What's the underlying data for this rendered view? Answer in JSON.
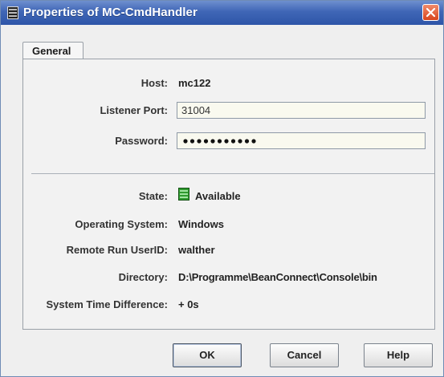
{
  "window": {
    "title": "Properties of MC-CmdHandler"
  },
  "tabs": [
    {
      "label": "General"
    }
  ],
  "form": {
    "host": {
      "label": "Host:",
      "value": "mc122"
    },
    "listener_port": {
      "label": "Listener Port:",
      "value": "31004"
    },
    "password": {
      "label": "Password:",
      "value": "•••••••••••"
    }
  },
  "info": {
    "state": {
      "label": "State:",
      "value": "Available",
      "icon": "server-available-icon"
    },
    "os": {
      "label": "Operating System:",
      "value": "Windows"
    },
    "userid": {
      "label": "Remote Run UserID:",
      "value": "walther"
    },
    "directory": {
      "label": "Directory:",
      "value": "D:\\Programme\\BeanConnect\\Console\\bin"
    },
    "time_diff": {
      "label": "System Time Difference:",
      "value": "+ 0s"
    }
  },
  "buttons": {
    "ok": "OK",
    "cancel": "Cancel",
    "help": "Help"
  },
  "colors": {
    "titlebar": "#3f66b6",
    "close": "#d8451d",
    "status_green": "#2f9a2f"
  }
}
